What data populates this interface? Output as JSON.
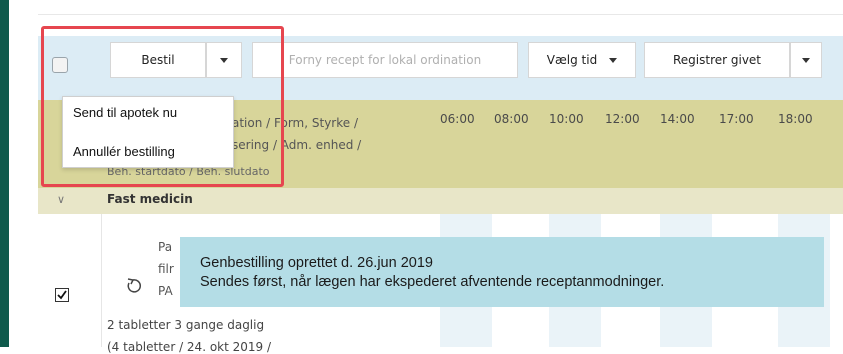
{
  "toolbar": {
    "order_label": "Bestil",
    "renew_label": "Forny recept for lokal ordination",
    "time_label": "Vælg tid",
    "register_label": "Registrer givet"
  },
  "header": {
    "line1": "ation / Form, Styrke /",
    "line2": "sering / Adm. enhed /",
    "line3": "Beh. startdato / Beh. slutdato",
    "times": [
      "06:00",
      "08:00",
      "10:00",
      "12:00",
      "14:00",
      "17:00",
      "18:00"
    ]
  },
  "group": {
    "label": "Fast medicin"
  },
  "medication": {
    "line1": "Pa",
    "line2": "filr",
    "line3": "PA",
    "dose": "2 tabletter 3 gange daglig",
    "clipped": "(4 tabletter / 24. okt 2019 /"
  },
  "tooltip": {
    "line1": "Genbestilling oprettet d. 26.jun 2019",
    "line2": "Sendes først, når lægen har ekspederet afventende receptanmodninger."
  },
  "dropdown": {
    "items": [
      "Send til apotek nu",
      "Annullér bestilling"
    ]
  },
  "colors": {
    "rail": "#0f5a4c",
    "toolbar_bg": "#dcecf5",
    "header_bg": "#d8d59a",
    "tooltip_bg": "#b4dde6",
    "highlight": "#e6464f"
  }
}
